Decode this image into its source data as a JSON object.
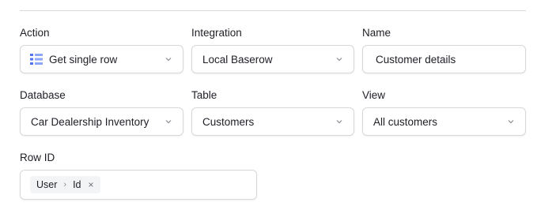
{
  "action": {
    "label": "Action",
    "value": "Get single row",
    "icon": "table-rows-icon",
    "icon_color": "#4e74f2"
  },
  "integration": {
    "label": "Integration",
    "value": "Local Baserow"
  },
  "name": {
    "label": "Name",
    "value": "Customer details"
  },
  "database": {
    "label": "Database",
    "value": "Car Dealership Inventory"
  },
  "table": {
    "label": "Table",
    "value": "Customers"
  },
  "view": {
    "label": "View",
    "value": "All customers"
  },
  "row_id": {
    "label": "Row ID",
    "chip": {
      "part1": "User",
      "separator": "›",
      "part2": "Id",
      "remove": "×"
    }
  }
}
